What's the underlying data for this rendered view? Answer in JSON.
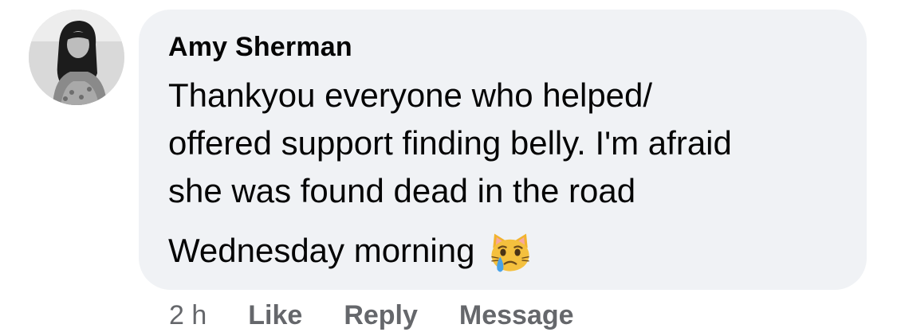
{
  "comment": {
    "author": "Amy Sherman",
    "lines": [
      "Thankyou everyone who helped/",
      "offered support finding belly. I'm afraid",
      "she was found dead in the road",
      "Wednesday morning"
    ],
    "emoji": "crying-cat-face-icon"
  },
  "meta": {
    "timestamp": "2 h",
    "like_label": "Like",
    "reply_label": "Reply",
    "message_label": "Message"
  },
  "colors": {
    "bubble_bg": "#f0f2f5",
    "text": "#050505",
    "secondary_text": "#65676b"
  }
}
